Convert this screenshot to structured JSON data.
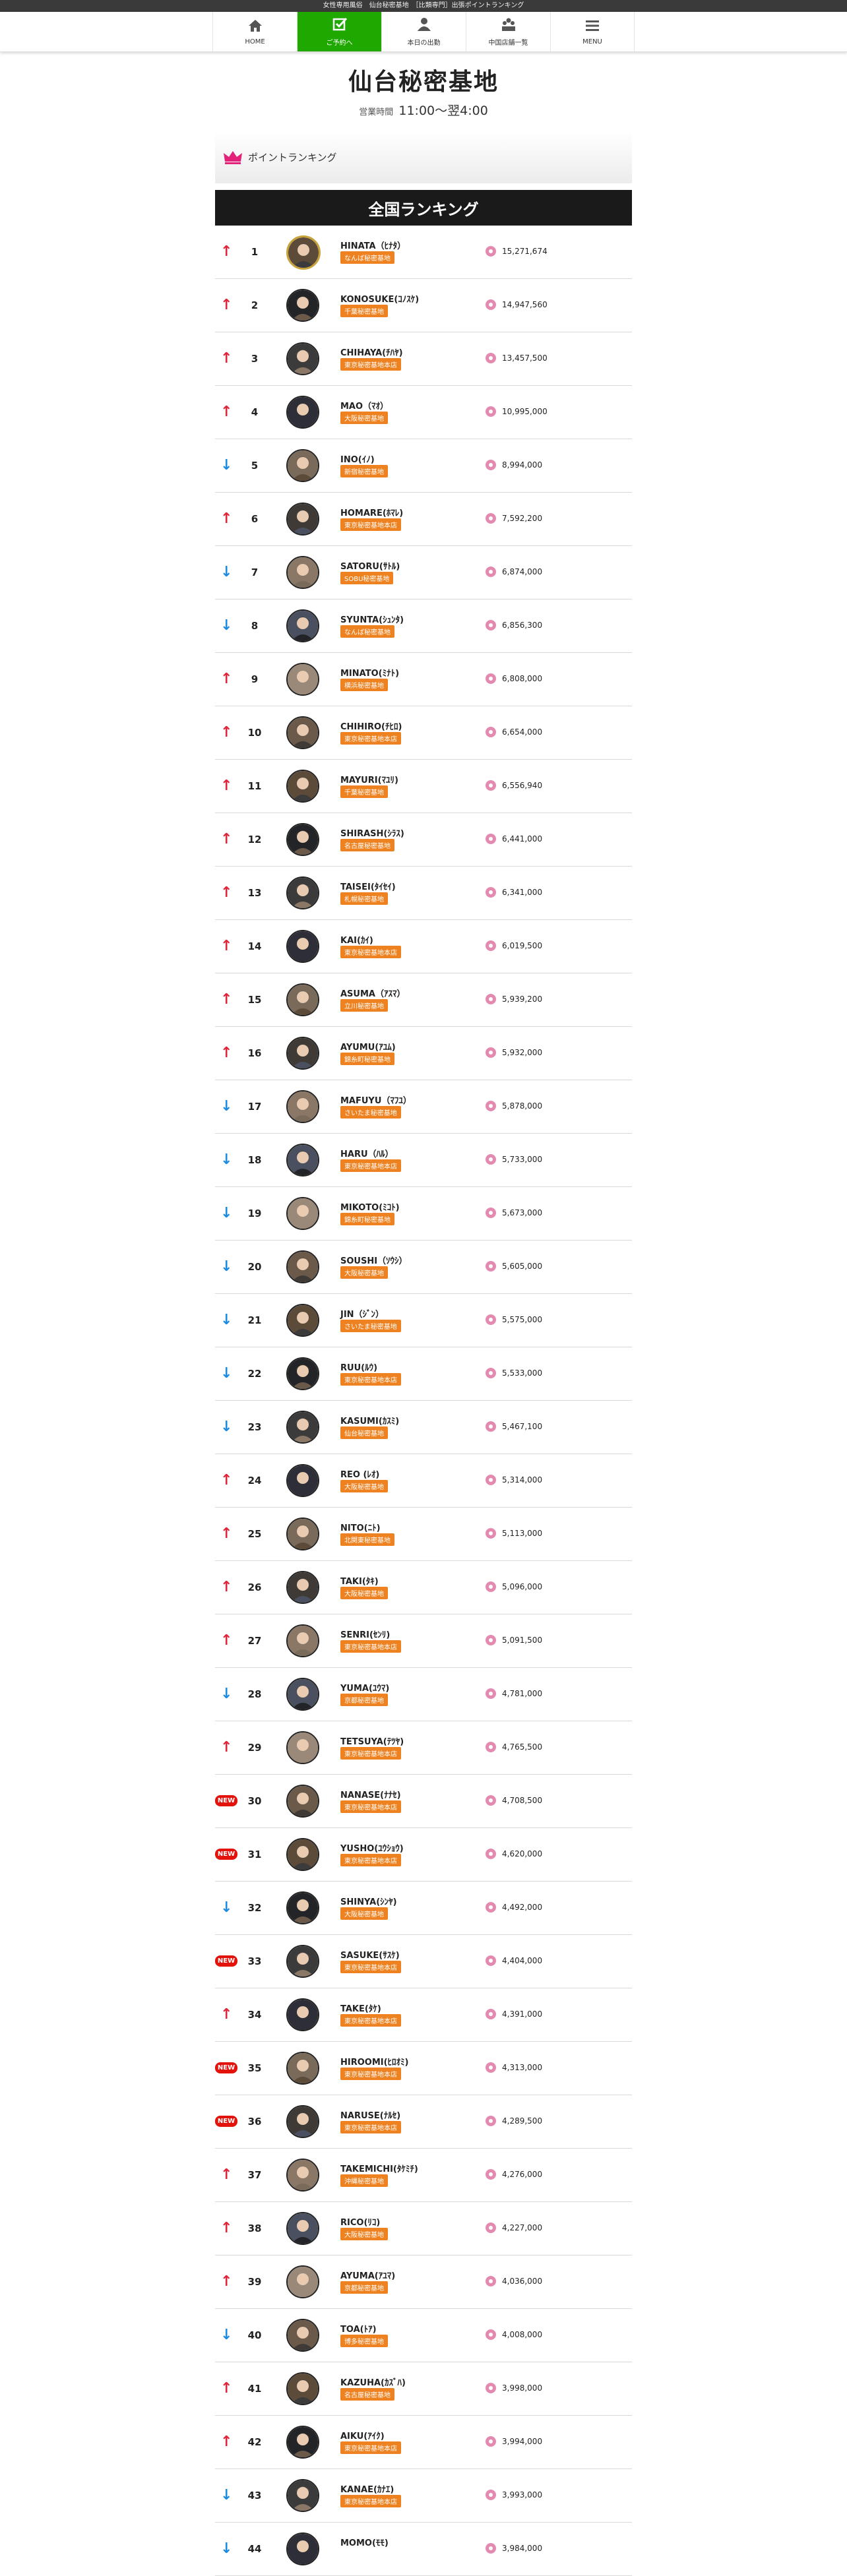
{
  "topbar": {
    "text": "女性専用風俗　仙台秘密基地　［比類専門］出張ポイントランキング"
  },
  "nav": [
    {
      "label": "HOME",
      "icon": "home-icon",
      "name": "nav-home",
      "active": false
    },
    {
      "label": "ご予約へ",
      "icon": "checkbox-icon",
      "name": "nav-reservation",
      "active": true
    },
    {
      "label": "本日の出勤",
      "icon": "person-icon",
      "name": "nav-today-attendance",
      "active": false
    },
    {
      "label": "中国店舗一覧",
      "icon": "group-icon",
      "name": "nav-store-list",
      "active": false
    },
    {
      "label": "MENU",
      "icon": "hamburger-icon",
      "name": "nav-menu",
      "active": false
    }
  ],
  "shop": {
    "title": "仙台秘密基地",
    "hours_label": "営業時間",
    "hours_value": "11:00〜翌4:00"
  },
  "panel": {
    "heading": "ポイントランキング",
    "heading_icon": "crown-icon",
    "ranking_title": "全国ランキング"
  },
  "colors": {
    "accent_green": "#1ea800",
    "badge_orange": "#ef8220",
    "up_red": "#e0243a",
    "down_blue": "#1c8be0",
    "new_red": "#e3130c",
    "coin_pink": "#e48ab0"
  },
  "ranking": [
    {
      "rank": "1",
      "trend": "up",
      "name": "HINATA（ﾋﾅﾀ）",
      "shop": "なんば秘密基地",
      "points": "15,271,674"
    },
    {
      "rank": "2",
      "trend": "up",
      "name": "KONOSUKE(ｺﾉｽｹ)",
      "shop": "千葉秘密基地",
      "points": "14,947,560"
    },
    {
      "rank": "3",
      "trend": "up",
      "name": "CHIHAYA(ﾁﾊﾔ)",
      "shop": "東京秘密基地本店",
      "points": "13,457,500"
    },
    {
      "rank": "4",
      "trend": "up",
      "name": "MAO（ﾏｵ）",
      "shop": "大阪秘密基地",
      "points": "10,995,000"
    },
    {
      "rank": "5",
      "trend": "down",
      "name": "INO(ｲﾉ)",
      "shop": "新宿秘密基地",
      "points": "8,994,000"
    },
    {
      "rank": "6",
      "trend": "up",
      "name": "HOMARE(ﾎﾏﾚ)",
      "shop": "東京秘密基地本店",
      "points": "7,592,200"
    },
    {
      "rank": "7",
      "trend": "down",
      "name": "SATORU(ｻﾄﾙ)",
      "shop": "SOBU秘密基地",
      "points": "6,874,000"
    },
    {
      "rank": "8",
      "trend": "down",
      "name": "SYUNTA(ｼｭﾝﾀ)",
      "shop": "なんば秘密基地",
      "points": "6,856,300"
    },
    {
      "rank": "9",
      "trend": "up",
      "name": "MINATO(ﾐﾅﾄ)",
      "shop": "横浜秘密基地",
      "points": "6,808,000"
    },
    {
      "rank": "10",
      "trend": "up",
      "name": "CHIHIRO(ﾁﾋﾛ)",
      "shop": "東京秘密基地本店",
      "points": "6,654,000"
    },
    {
      "rank": "11",
      "trend": "up",
      "name": "MAYURI(ﾏﾕﾘ)",
      "shop": "千葉秘密基地",
      "points": "6,556,940"
    },
    {
      "rank": "12",
      "trend": "up",
      "name": "SHIRASH(ｼﾗｽ)",
      "shop": "名古屋秘密基地",
      "points": "6,441,000"
    },
    {
      "rank": "13",
      "trend": "up",
      "name": "TAISEI(ﾀｲｾｲ)",
      "shop": "札幌秘密基地",
      "points": "6,341,000"
    },
    {
      "rank": "14",
      "trend": "up",
      "name": "KAI(ｶｲ)",
      "shop": "東京秘密基地本店",
      "points": "6,019,500"
    },
    {
      "rank": "15",
      "trend": "up",
      "name": "ASUMA（ｱｽﾏ）",
      "shop": "立川秘密基地",
      "points": "5,939,200"
    },
    {
      "rank": "16",
      "trend": "up",
      "name": "AYUMU(ｱﾕﾑ)",
      "shop": "錦糸町秘密基地",
      "points": "5,932,000"
    },
    {
      "rank": "17",
      "trend": "down",
      "name": "MAFUYU（ﾏﾌﾕ）",
      "shop": "さいたま秘密基地",
      "points": "5,878,000"
    },
    {
      "rank": "18",
      "trend": "down",
      "name": "HARU（ﾊﾙ）",
      "shop": "東京秘密基地本店",
      "points": "5,733,000"
    },
    {
      "rank": "19",
      "trend": "down",
      "name": "MIKOTO(ﾐｺﾄ)",
      "shop": "錦糸町秘密基地",
      "points": "5,673,000"
    },
    {
      "rank": "20",
      "trend": "down",
      "name": "SOUSHI（ｿｳｼ）",
      "shop": "大阪秘密基地",
      "points": "5,605,000"
    },
    {
      "rank": "21",
      "trend": "down",
      "name": "JIN（ｼﾞﾝ）",
      "shop": "さいたま秘密基地",
      "points": "5,575,000"
    },
    {
      "rank": "22",
      "trend": "down",
      "name": "RUU(ﾙｳ)",
      "shop": "東京秘密基地本店",
      "points": "5,533,000"
    },
    {
      "rank": "23",
      "trend": "down",
      "name": "KASUMI(ｶｽﾐ)",
      "shop": "仙台秘密基地",
      "points": "5,467,100"
    },
    {
      "rank": "24",
      "trend": "up",
      "name": "REO (ﾚｵ)",
      "shop": "大阪秘密基地",
      "points": "5,314,000"
    },
    {
      "rank": "25",
      "trend": "up",
      "name": "NITO(ﾆﾄ)",
      "shop": "北関東秘密基地",
      "points": "5,113,000"
    },
    {
      "rank": "26",
      "trend": "up",
      "name": "TAKI(ﾀｷ)",
      "shop": "大阪秘密基地",
      "points": "5,096,000"
    },
    {
      "rank": "27",
      "trend": "up",
      "name": "SENRI(ｾﾝﾘ)",
      "shop": "東京秘密基地本店",
      "points": "5,091,500"
    },
    {
      "rank": "28",
      "trend": "down",
      "name": "YUMA(ﾕｳﾏ)",
      "shop": "京都秘密基地",
      "points": "4,781,000"
    },
    {
      "rank": "29",
      "trend": "up",
      "name": "TETSUYA(ﾃﾂﾔ)",
      "shop": "東京秘密基地本店",
      "points": "4,765,500"
    },
    {
      "rank": "30",
      "trend": "new",
      "name": "NANASE(ﾅﾅｾ)",
      "shop": "東京秘密基地本店",
      "points": "4,708,500"
    },
    {
      "rank": "31",
      "trend": "new",
      "name": "YUSHO(ﾕｳｼｮｳ)",
      "shop": "東京秘密基地本店",
      "points": "4,620,000"
    },
    {
      "rank": "32",
      "trend": "down",
      "name": "SHINYA(ｼﾝﾔ)",
      "shop": "大阪秘密基地",
      "points": "4,492,000"
    },
    {
      "rank": "33",
      "trend": "new",
      "name": "SASUKE(ｻｽｹ)",
      "shop": "東京秘密基地本店",
      "points": "4,404,000"
    },
    {
      "rank": "34",
      "trend": "up",
      "name": "TAKE(ﾀｹ)",
      "shop": "東京秘密基地本店",
      "points": "4,391,000"
    },
    {
      "rank": "35",
      "trend": "new",
      "name": "HIROOMI(ﾋﾛｵﾐ)",
      "shop": "東京秘密基地本店",
      "points": "4,313,000"
    },
    {
      "rank": "36",
      "trend": "new",
      "name": "NARUSE(ﾅﾙｾ)",
      "shop": "東京秘密基地本店",
      "points": "4,289,500"
    },
    {
      "rank": "37",
      "trend": "up",
      "name": "TAKEMICHI(ﾀｹﾐﾁ)",
      "shop": "沖縄秘密基地",
      "points": "4,276,000"
    },
    {
      "rank": "38",
      "trend": "up",
      "name": "RICO(ﾘｺ)",
      "shop": "大阪秘密基地",
      "points": "4,227,000"
    },
    {
      "rank": "39",
      "trend": "up",
      "name": "AYUMA(ｱﾕﾏ)",
      "shop": "京都秘密基地",
      "points": "4,036,000"
    },
    {
      "rank": "40",
      "trend": "down",
      "name": "TOA(ﾄｱ)",
      "shop": "博多秘密基地",
      "points": "4,008,000"
    },
    {
      "rank": "41",
      "trend": "up",
      "name": "KAZUHA(ｶｽﾞﾊ)",
      "shop": "名古屋秘密基地",
      "points": "3,998,000"
    },
    {
      "rank": "42",
      "trend": "up",
      "name": "AIKU(ｱｲｸ)",
      "shop": "東京秘密基地本店",
      "points": "3,994,000"
    },
    {
      "rank": "43",
      "trend": "down",
      "name": "KANAE(ｶﾅｴ)",
      "shop": "東京秘密基地本店",
      "points": "3,993,000"
    },
    {
      "rank": "44",
      "trend": "down",
      "name": "MOMO(ﾓﾓ)",
      "shop": "",
      "points": "3,984,000"
    }
  ]
}
